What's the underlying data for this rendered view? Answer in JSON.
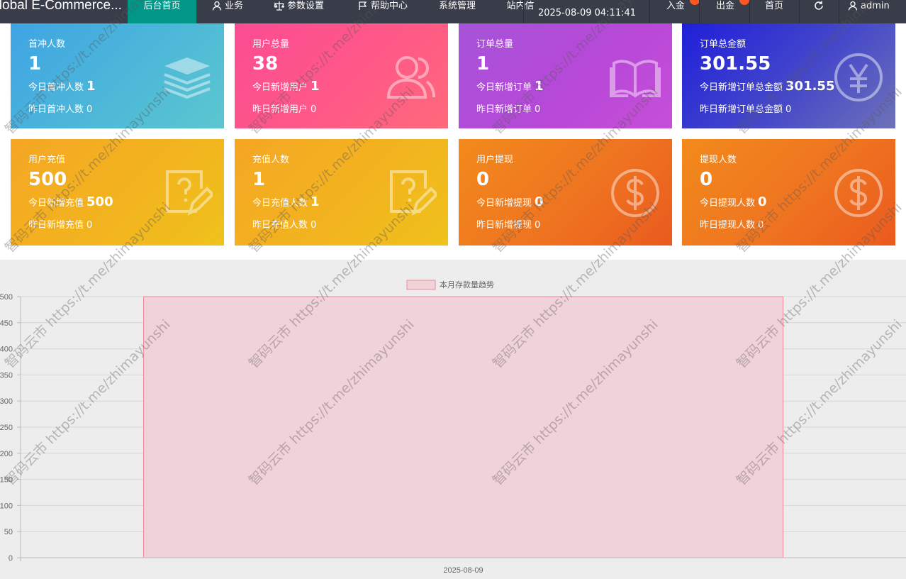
{
  "topnav": {
    "brand": "Global E-Commerce...",
    "items": [
      {
        "label": "后台首页"
      },
      {
        "label": "业务"
      },
      {
        "label": "参数设置"
      },
      {
        "label": "帮助中心"
      },
      {
        "label": "系统管理"
      },
      {
        "label": "站内信"
      }
    ],
    "datetime": "2025-08-09 04:11:41",
    "deposit_label": "入金",
    "withdraw_label": "出金",
    "home_label": "首页",
    "user_label": "admin",
    "accent_color": "#009688",
    "bar_color": "#393d49",
    "badge_color": "#ff5722"
  },
  "cards": [
    {
      "title": "首冲人数",
      "value": "1",
      "today_label": "今日首冲人数",
      "today_value": "1",
      "yesterday_label": "昨日首冲人数",
      "yesterday_value": "0",
      "icon": "layers-icon"
    },
    {
      "title": "用户总量",
      "value": "38",
      "today_label": "今日新增用户",
      "today_value": "1",
      "yesterday_label": "昨日新增用户",
      "yesterday_value": "0",
      "icon": "users-icon"
    },
    {
      "title": "订单总量",
      "value": "1",
      "today_label": "今日新增订单",
      "today_value": "1",
      "yesterday_label": "昨日新增订单",
      "yesterday_value": "0",
      "icon": "book-icon"
    },
    {
      "title": "订单总金额",
      "value": "301.55",
      "today_label": "今日新增订单总金额",
      "today_value": "301.55",
      "yesterday_label": "昨日新增订单总金额",
      "yesterday_value": "0",
      "icon": "yen-icon"
    },
    {
      "title": "用户充值",
      "value": "500",
      "today_label": "今日新增充值",
      "today_value": "500",
      "yesterday_label": "昨日新增充值",
      "yesterday_value": "0",
      "icon": "question-note-icon"
    },
    {
      "title": "充值人数",
      "value": "1",
      "today_label": "今日充值人数",
      "today_value": "1",
      "yesterday_label": "昨日充值人数",
      "yesterday_value": "0",
      "icon": "question-note-icon"
    },
    {
      "title": "用户提现",
      "value": "0",
      "today_label": "今日新增提现",
      "today_value": "0",
      "yesterday_label": "昨日新增提现",
      "yesterday_value": "0",
      "icon": "dollar-icon"
    },
    {
      "title": "提现人数",
      "value": "0",
      "today_label": "今日提现人数",
      "today_value": "0",
      "yesterday_label": "昨日提现人数",
      "yesterday_value": "0",
      "icon": "dollar-icon"
    }
  ],
  "chart_data": {
    "type": "area",
    "legend": "本月存款量趋势",
    "legend_position": "top",
    "categories": [
      "2025-08-09"
    ],
    "series": [
      {
        "name": "本月存款量趋势",
        "values": [
          500
        ]
      }
    ],
    "yticks": [
      0,
      50,
      100,
      150,
      200,
      250,
      300,
      350,
      400,
      450,
      500
    ],
    "ylim": [
      0,
      500
    ],
    "grid": true,
    "fill_color": "#f0d3d8",
    "line_color": "#f08a9c"
  },
  "watermark": {
    "text": "智码云市 https://t.me/zhimayunshi"
  }
}
